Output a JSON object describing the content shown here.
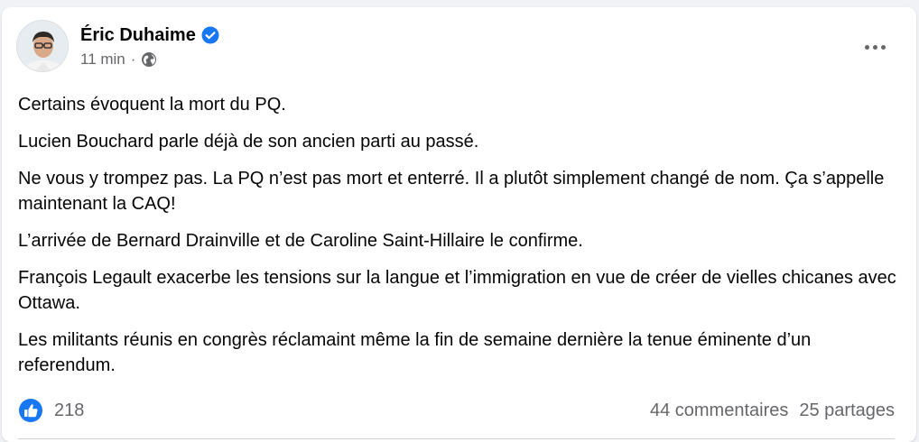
{
  "post": {
    "author": "Éric Duhaime",
    "time": "11 min",
    "separator": "·",
    "paragraphs": [
      "Certains évoquent la mort du PQ.",
      "Lucien Bouchard parle déjà de son ancien parti au passé.",
      "Ne vous y trompez pas. La PQ n’est pas mort et enterré. Il a plutôt simplement changé de nom. Ça s’appelle maintenant la CAQ!",
      "L’arrivée de Bernard Drainville et de Caroline Saint-Hillaire le confirme.",
      "François Legault exacerbe les tensions sur la langue et l’immigration en vue de créer de vielles chicanes avec Ottawa.",
      "Les militants réunis en congrès réclamaint même la fin de semaine dernière la tenue éminente d’un referendum."
    ],
    "reactions_count": "218",
    "comments": "44 commentaires",
    "shares": "25 partages"
  },
  "icons": {
    "verified": "verified-badge-icon",
    "audience": "globe-icon",
    "reaction": "like-icon",
    "menu": "more-options-icon"
  },
  "colors": {
    "accent": "#1877f2",
    "secondary_text": "#65676b",
    "primary_text": "#050505"
  }
}
